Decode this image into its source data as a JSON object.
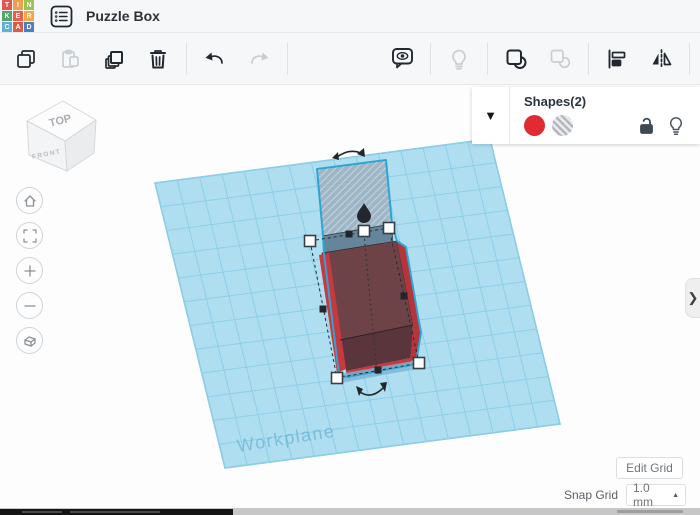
{
  "app": {
    "title": "Puzzle Box"
  },
  "logo": {
    "letters": [
      "T",
      "I",
      "N",
      "K",
      "E",
      "R",
      "C",
      "A",
      "D"
    ],
    "colors": [
      "#e2574c",
      "#f2a04e",
      "#9dc24d",
      "#56a469",
      "#e8604c",
      "#f3a64c",
      "#5eb2d6",
      "#dd5a4b",
      "#4d7fc0"
    ]
  },
  "toolbar": {
    "left_icons": [
      {
        "name": "copy-icon",
        "enabled": true
      },
      {
        "name": "paste-icon",
        "enabled": false
      },
      {
        "name": "duplicate-icon",
        "enabled": true
      },
      {
        "name": "delete-icon",
        "enabled": true
      },
      {
        "name": "undo-icon",
        "enabled": true
      },
      {
        "name": "redo-icon",
        "enabled": false
      }
    ],
    "right_icons": [
      {
        "name": "hide-icon",
        "enabled": true
      },
      {
        "name": "show-all-icon",
        "enabled": false
      },
      {
        "name": "group-icon",
        "enabled": true
      },
      {
        "name": "ungroup-icon",
        "enabled": false
      },
      {
        "name": "align-icon",
        "enabled": true
      },
      {
        "name": "mirror-icon",
        "enabled": true
      }
    ]
  },
  "panel": {
    "title": "Shapes(2)",
    "dropdown_icon": "▼",
    "swatches": [
      {
        "name": "red-solid-swatch",
        "color": "#df2b31"
      },
      {
        "name": "hole-striped-swatch",
        "pattern": "gray-stripes"
      }
    ],
    "icons": [
      "unlock-icon",
      "bulb-icon"
    ]
  },
  "viewcube": {
    "top": "TOP",
    "front": "FRONT"
  },
  "nav_icons": [
    "home-icon",
    "fit-view-icon",
    "zoom-in-icon",
    "zoom-out-icon",
    "ortho-view-icon"
  ],
  "scene": {
    "workplane_label": "Workplane",
    "colors": {
      "grid_fill": "#b0def1",
      "grid_line": "#8ccfe8",
      "selection_outline": "#29a8d6",
      "box_red_bright": "#c8393f",
      "box_red_top": "#6d4348",
      "box_red_front": "#5a363c",
      "hole_gray": "#9db0bf",
      "hole_gray_front": "#5f7e93"
    }
  },
  "side_toggle": {
    "chevron": "❯"
  },
  "footer": {
    "edit_grid": "Edit Grid",
    "snap_label": "Snap Grid",
    "snap_value": "1.0 mm",
    "snap_arrow": "▲"
  }
}
